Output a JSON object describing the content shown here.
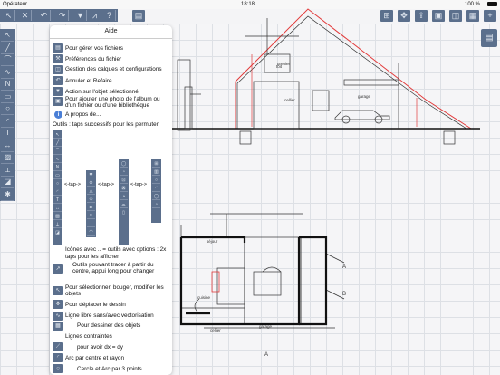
{
  "status_bar": {
    "carrier": "Opérateur",
    "time": "18:18",
    "battery": "100 %"
  },
  "toolbar": {
    "left_icons": [
      "pointer-icon",
      "close-icon",
      "undo-icon",
      "redo-icon",
      "triangle-down-icon",
      "zigzag-icon",
      "help-icon"
    ],
    "left_glyphs": [
      "↖",
      "✕",
      "↶",
      "↷",
      "▼",
      "⩘",
      "?"
    ],
    "center_icon_glyph": "▤",
    "right_icons": [
      "grid-icon",
      "move-icon",
      "export-icon",
      "photo-icon",
      "layers-icon",
      "calculator-icon",
      "plus-icon"
    ],
    "right_glyphs": [
      "⊞",
      "✥",
      "⇪",
      "▣",
      "◫",
      "▦",
      "+"
    ]
  },
  "left_tools": {
    "icons": [
      "select-icon",
      "line-icon",
      "polyline-icon",
      "freehand-icon",
      "zigzag-icon",
      "rectangle-icon",
      "circle-icon",
      "arc-icon",
      "text-icon",
      "dimension-icon",
      "hatch-icon",
      "measure-icon",
      "symbol-icon",
      "settings-icon"
    ],
    "glyphs": [
      "↖",
      "╱",
      "⌒",
      "∿",
      "N",
      "▭",
      "○",
      "◜",
      "T",
      "↔",
      "▨",
      "⟂",
      "◪",
      "✱"
    ]
  },
  "right_tools": {
    "glyph": "▤"
  },
  "help": {
    "title": "Aide",
    "items": [
      {
        "glyph": "▤",
        "label": "Pour gérer vos fichiers"
      },
      {
        "glyph": "⚒",
        "label": "Préférences du fichier"
      },
      {
        "glyph": "◫",
        "label": "Gestion des calques et configurations"
      },
      {
        "glyph": "↶",
        "label": "Annuler et Refaire"
      },
      {
        "glyph": "▼",
        "label": "Action sur l'objet sélectionné"
      },
      {
        "glyph": "▣",
        "label": "Pour ajouter une photo de l'album ou d'un fichier ou d'une bibliothèque"
      },
      {
        "glyph": "i",
        "label": "A propos de..."
      }
    ],
    "tools_heading": "Outils : taps successifs pour les permuter",
    "tap_label": "<-tap->",
    "options_note": "Icônes avec .. = outils avec options : 2x taps pour les afficher",
    "tool_items": [
      {
        "glyph": "↗",
        "label": "Outils pouvant tracer à partir du centre, appui long pour changer"
      },
      {
        "glyph": "↖",
        "label": "Pour sélectionner, bouger, modifier les objets"
      },
      {
        "glyph": "✥",
        "label": "Pour déplacer le dessin"
      },
      {
        "glyph": "∿",
        "label": "Ligne libre sans/avec vectorisation"
      },
      {
        "glyph": "▦",
        "label": "Pour dessiner des objets"
      },
      {
        "glyph": "",
        "label": "Lignes contraintes"
      },
      {
        "glyph": "⟋",
        "label": "pour avoir dx = dy"
      },
      {
        "glyph": "◜",
        "label": "Arc par centre et rayon"
      },
      {
        "glyph": "○",
        "label": "Cercle et Arc par 3 points"
      }
    ],
    "tool_column_glyphs": [
      "↖",
      "╱",
      "⌒",
      "∿",
      "N",
      "▭",
      "○",
      "◜",
      "T",
      "↔",
      "▨",
      "⟂",
      "◪",
      "✱",
      "⊙",
      "△",
      "◇",
      "⊏",
      "≡",
      "⌇",
      "◠",
      "◯",
      "◔",
      "⊡",
      "⊠",
      "◑",
      "⌓",
      "▯",
      "⊞",
      "▥"
    ]
  },
  "drawing": {
    "labels": [
      "grenier",
      "toit",
      "cellier",
      "garage",
      "séjour",
      "garage",
      "cuisine",
      "cellier",
      "A",
      "B",
      "A"
    ],
    "accent_red": "#e23b3b",
    "line_color": "#333333"
  },
  "colors": {
    "toolbar": "#5b6f8c",
    "accent_blue": "#4a7fd6",
    "grid": "#dde0e5"
  }
}
